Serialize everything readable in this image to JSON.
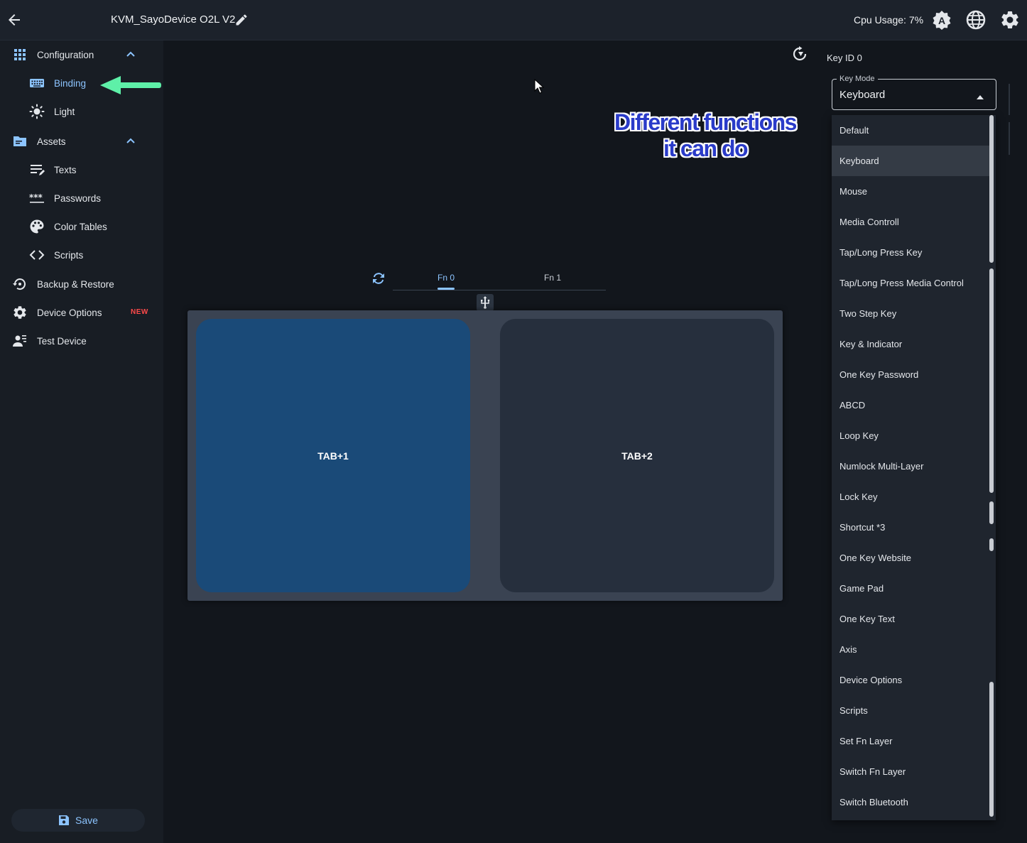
{
  "header": {
    "device_name": "KVM_SayoDevice O2L V2",
    "cpu_usage": "Cpu Usage: 7%"
  },
  "sidebar": {
    "configuration": {
      "label": "Configuration",
      "items": [
        {
          "label": "Binding"
        },
        {
          "label": "Light"
        }
      ]
    },
    "assets": {
      "label": "Assets",
      "items": [
        {
          "label": "Texts"
        },
        {
          "label": "Passwords"
        },
        {
          "label": "Color Tables"
        },
        {
          "label": "Scripts"
        }
      ]
    },
    "backup": {
      "label": "Backup & Restore"
    },
    "device_options": {
      "label": "Device Options",
      "badge": "NEW"
    },
    "test_device": {
      "label": "Test Device"
    },
    "save_label": "Save"
  },
  "annotation": {
    "line1": "Different functions",
    "line2": "it can do"
  },
  "fn_tabs": [
    {
      "label": "Fn 0",
      "active": true
    },
    {
      "label": "Fn 1",
      "active": false
    }
  ],
  "keys": [
    {
      "label": "TAB+1",
      "selected": true
    },
    {
      "label": "TAB+2",
      "selected": false
    }
  ],
  "panel": {
    "key_id": "Key ID 0",
    "key_mode_label": "Key Mode",
    "key_mode_value": "Keyboard"
  },
  "key_mode_options": [
    "Default",
    "Keyboard",
    "Mouse",
    "Media Controll",
    "Tap/Long Press Key",
    "Tap/Long Press Media Control",
    "Two Step Key",
    "Key & Indicator",
    "One Key Password",
    "ABCD",
    "Loop Key",
    "Numlock Multi-Layer",
    "Lock Key",
    "Shortcut *3",
    "One Key Website",
    "Game Pad",
    "One Key Text",
    "Axis",
    "Device Options",
    "Scripts",
    "Set Fn Layer",
    "Switch Fn Layer",
    "Switch Bluetooth"
  ],
  "selected_option_index": 1,
  "colors": {
    "accent": "#8cc4ff",
    "selected_key": "#1a4a78",
    "annotation_arrow": "#5ef0a8",
    "new_badge": "#ff4a4a"
  }
}
